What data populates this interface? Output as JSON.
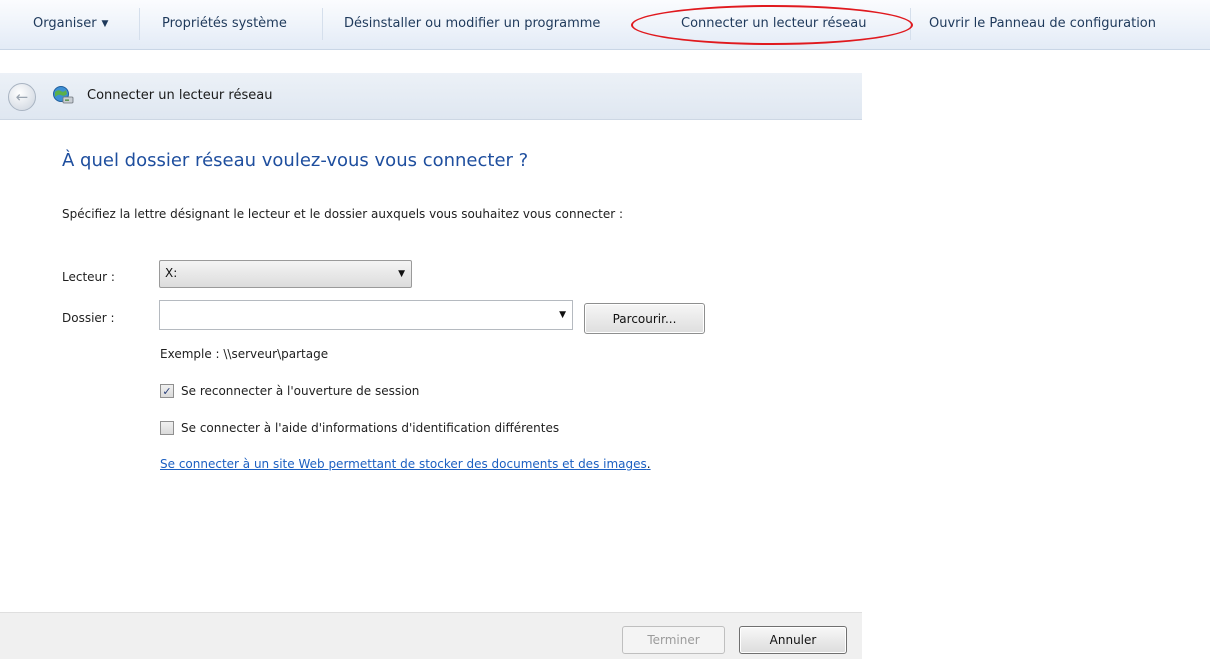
{
  "toolbar": {
    "items": [
      {
        "label": "Organiser"
      },
      {
        "label": "Propriétés système"
      },
      {
        "label": "Désinstaller ou modifier un programme"
      },
      {
        "label": "Connecter un lecteur réseau"
      },
      {
        "label": "Ouvrir le Panneau de configuration"
      }
    ]
  },
  "wizard": {
    "title": "Connecter un lecteur réseau",
    "heading": "À quel dossier réseau voulez-vous vous connecter ?",
    "instruction": "Spécifiez la lettre désignant le lecteur et le dossier auxquels vous souhaitez vous connecter :",
    "drive": {
      "label": "Lecteur :",
      "value": "X:"
    },
    "folder": {
      "label": "Dossier :",
      "value": "",
      "browse_label": "Parcourir..."
    },
    "example": "Exemple : \\\\serveur\\partage",
    "reconnect": {
      "label": "Se reconnecter à l'ouverture de session",
      "checked": true
    },
    "other_credentials": {
      "label": "Se connecter à l'aide d'informations d'identification différentes",
      "checked": false
    },
    "web_link": {
      "text": "Se connecter à un site Web permettant de stocker des documents et des images",
      "tail": "."
    },
    "buttons": {
      "finish": "Terminer",
      "cancel": "Annuler"
    }
  },
  "icons": {
    "back": "back-arrow-icon",
    "network": "network-drive-icon",
    "dropdown": "chevron-down-icon",
    "check": "checkmark-icon"
  },
  "colors": {
    "heading": "#1e4e9e",
    "link": "#1b5fc1",
    "highlight": "#e0191e",
    "toolbar_text": "#1e395b"
  }
}
